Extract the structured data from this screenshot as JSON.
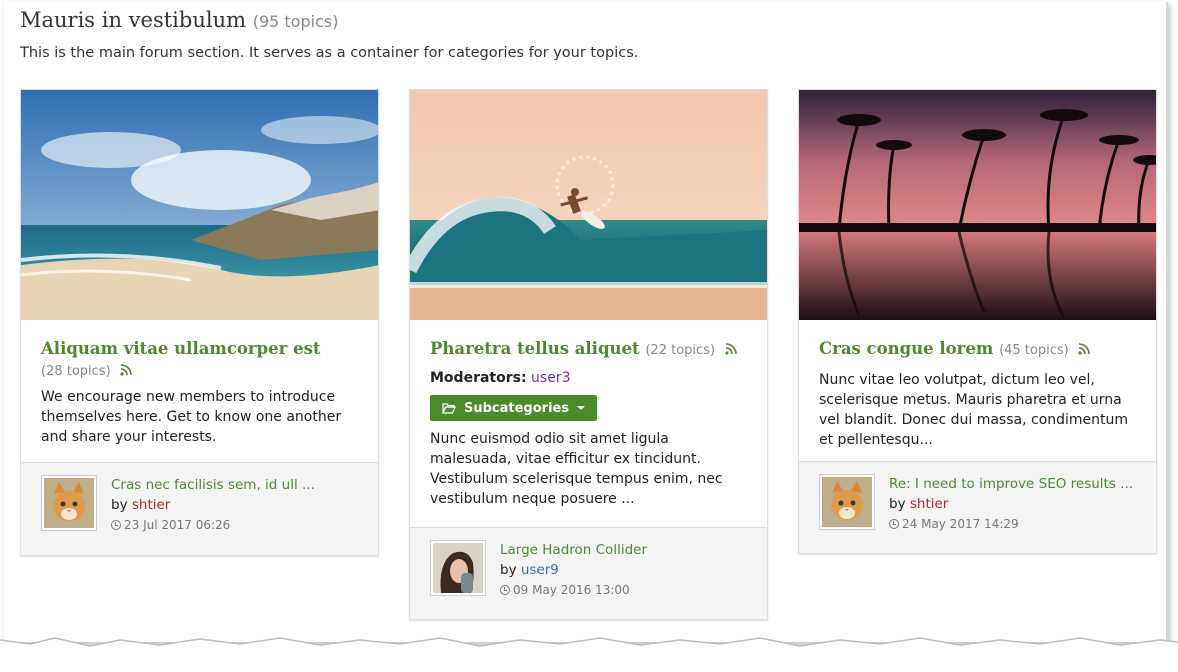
{
  "section": {
    "title": "Mauris in vestibulum",
    "topic_count": "(95 topics)",
    "description": "This is the main forum section. It serves as a container for categories for your topics."
  },
  "categories": [
    {
      "title": "Aliquam vitae ullamcorper est",
      "topic_count": "(28 topics)",
      "description": "We encourage new members to introduce themselves here. Get to know one another and share your interests.",
      "image": "beach-photo",
      "last_post": {
        "title": "Cras nec facilisis sem, id ull ...",
        "by_label": "by",
        "author": "shtier",
        "date": "23 Jul 2017 06:26",
        "avatar": "cat-avatar"
      }
    },
    {
      "title": "Pharetra tellus aliquet",
      "topic_count": "(22 topics)",
      "moderators_label": "Moderators:",
      "moderator": "user3",
      "subcategories_label": "Subcategories",
      "description": "Nunc euismod odio sit amet ligula malesuada, vitae efficitur ex tincidunt. Vestibulum scelerisque tempus enim, nec vestibulum neque posuere ...",
      "image": "surfer-photo",
      "last_post": {
        "title": "Large Hadron Collider",
        "by_label": "by",
        "author": "user9",
        "date": "09 May 2016 13:00",
        "avatar": "woman-avatar"
      }
    },
    {
      "title": "Cras congue lorem",
      "topic_count": "(45 topics)",
      "description": "Nunc vitae leo volutpat, dictum leo vel, scelerisque metus. Mauris pharetra et urna vel blandit. Donec dui massa, condimentum et pellentesqu...",
      "image": "palm-sunset-photo",
      "last_post": {
        "title": "Re: I need to improve SEO results ...",
        "by_label": "by",
        "author": "shtier",
        "date": "24 May 2017 14:29",
        "avatar": "cat-avatar"
      }
    }
  ],
  "colors": {
    "accent": "#4a8b2c",
    "author_red": "#b1262b",
    "author_blue": "#3d6bb0",
    "moderator": "#7b2c9c"
  }
}
